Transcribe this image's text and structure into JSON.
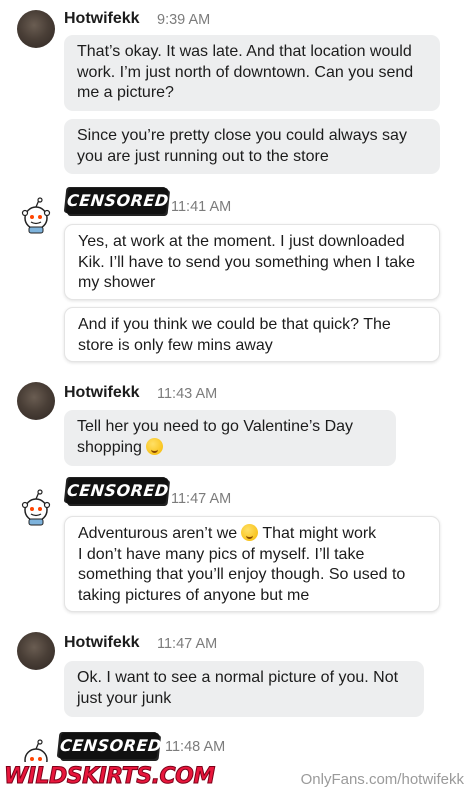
{
  "messages": [
    {
      "author": "Hotwifekk",
      "time": "9:39 AM",
      "bubbles": [
        "That’s okay. It was late. And that location would work. I’m just north of downtown. Can you send me a picture?",
        "Since you’re pretty close you could always say you are just running out to the store"
      ]
    },
    {
      "author_redaction": "CENSORED",
      "time": "11:41 AM",
      "bubbles": [
        "Yes, at work at the moment. I just downloaded Kik. I’ll have to send you something when I take my shower",
        "And if you think we could be that quick? The store is only few mins away"
      ]
    },
    {
      "author": "Hotwifekk",
      "time": "11:43 AM",
      "bubbles": [
        "Tell her you need to go Valentine’s Day shopping"
      ]
    },
    {
      "author_redaction": "CENSORED",
      "time": "11:47 AM",
      "bubbles": [
        "Adventurous aren’t we",
        "That might work\nI don’t have many pics of myself. I’ll take something that you’ll enjoy though. So used to taking pictures of anyone but me"
      ]
    },
    {
      "author": "Hotwifekk",
      "time": "11:47 AM",
      "bubbles": [
        "Ok. I want to see a normal picture of you. Not just your junk"
      ]
    },
    {
      "author_redaction": "CENSORED",
      "time": "11:48 AM"
    }
  ],
  "watermarks": {
    "left": "WILDSKIRTS.COM",
    "right": "OnlyFans.com/hotwifekk"
  },
  "emojis": [
    "winking-tongue-face-emoji",
    "winking-face-emoji"
  ],
  "colors": {
    "grey_bubble": "#edeeef",
    "white_bubble": "#ffffff",
    "timestamp": "#7c7c7c",
    "watermark_red": "#e8163c"
  }
}
